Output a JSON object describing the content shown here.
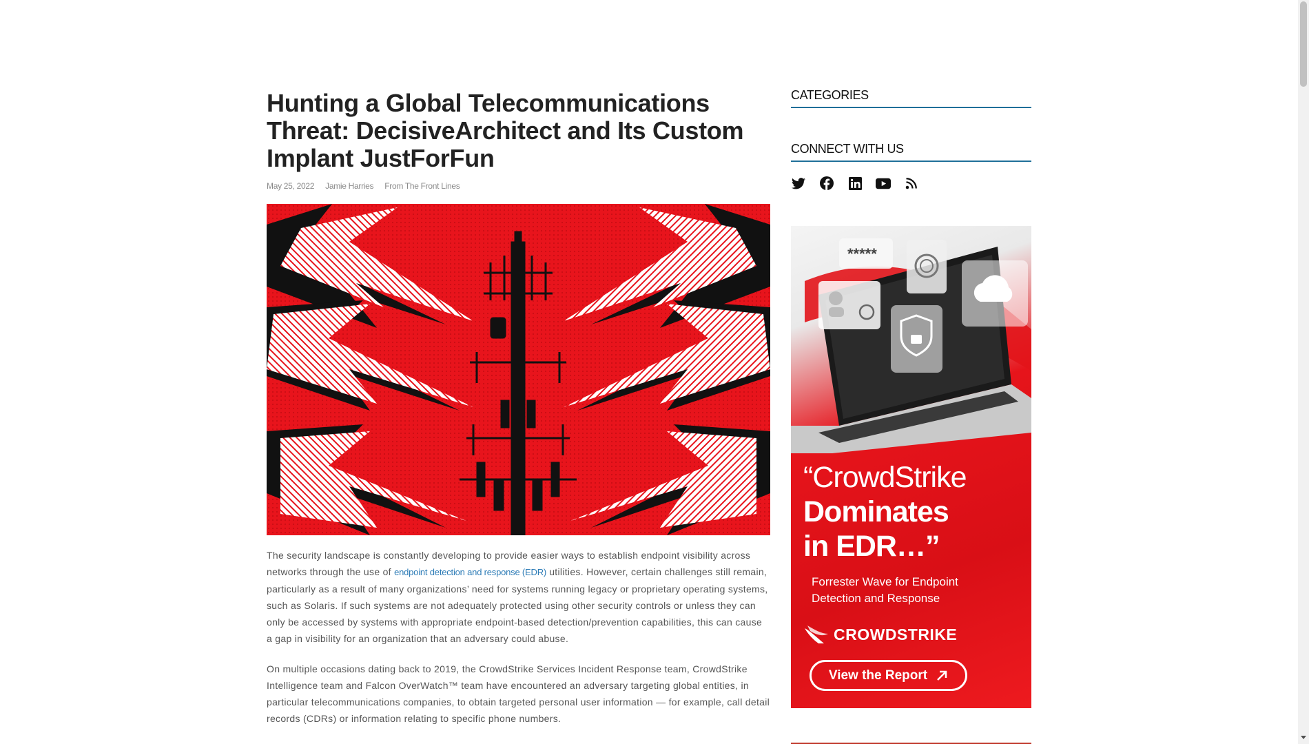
{
  "article": {
    "title": "Hunting a Global Telecommunications Threat: DecisiveArchitect and Its Custom Implant JustForFun",
    "date": "May 25, 2022",
    "author": "Jamie Harries",
    "category": "From The Front Lines",
    "hero_image": "red-cell-tower-lightning-illustration",
    "paragraphs": [
      {
        "before_link": "The security landscape is constantly developing to provide easier ways to establish endpoint visibility across networks through the use of ",
        "link": "endpoint detection and response (EDR)",
        "after_link": " utilities. However, certain challenges still remain, particularly as a result of many organizations’ need for systems running legacy or proprietary operating systems, such as Solaris. If such systems are not adequately protected using other security controls or unless they can only be accessed by systems with appropriate endpoint-based detection/prevention capabilities, this can cause a gap in visibility for an organization that an adversary could abuse."
      },
      {
        "text": "On multiple occasions dating back to 2019, the CrowdStrike Services Incident Response team, CrowdStrike Intelligence team and Falcon OverWatch™ team have encountered an adversary targeting global entities, in particular telecommunications companies, to obtain targeted personal user information — for example, call detail records (CDRs) or information relating to specific phone numbers."
      }
    ]
  },
  "sidebar": {
    "categories_title": "CATEGORIES",
    "connect_title": "CONNECT WITH US",
    "social": [
      "twitter-icon",
      "facebook-icon",
      "linkedin-icon",
      "youtube-icon",
      "rss-icon"
    ],
    "ad": {
      "quote_line1": "“CrowdStrike",
      "quote_line2": "Dominates",
      "quote_line3": "in EDR…”",
      "subtitle": "Forrester Wave for Endpoint Detection and Response",
      "brand": "CROWDSTRIKE",
      "button": "View the Report",
      "password_mask": "*****"
    }
  },
  "colors": {
    "accent_blue": "#1f6f99",
    "link": "#2c7bb6",
    "brand_red": "#e6141b"
  }
}
